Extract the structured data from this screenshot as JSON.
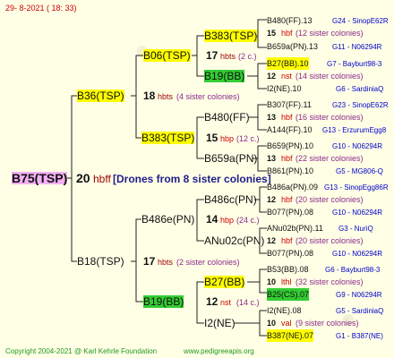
{
  "header": {
    "date": "29-  8-2021 ( 18: 33)"
  },
  "footer": {
    "copyright": "Copyright 2004-2021 @ Karl Kehrle Foundation",
    "site": "www.pedigreeapis.org"
  },
  "root": {
    "label": "B75(TSP)",
    "count": "20",
    "unit": "hbff",
    "note": "[Drones from 8 sister colonies]"
  },
  "g1": [
    {
      "label": "B36(TSP)",
      "count": "18",
      "unit": "hbts",
      "note": "(4 sister colonies)"
    },
    {
      "label": "B18(TSP)",
      "count": "17",
      "unit": "hbts",
      "note": "(2 sister colonies)"
    }
  ],
  "g2": [
    {
      "label": "B06(TSP)",
      "count": "17",
      "unit": "hbts",
      "note": "(2 c.)"
    },
    {
      "label": "B383(TSP)",
      "count": "15",
      "unit": "hbp",
      "note": "(12 c.)"
    },
    {
      "label": "B486e(PN)",
      "count": "14",
      "unit": "hbp",
      "note": "(24 c.)"
    },
    {
      "label": "B19(BB)",
      "count": "12",
      "unit": "nst",
      "note": "(14 c.)"
    }
  ],
  "g3": [
    {
      "label": "B383(TSP)"
    },
    {
      "label": "B19(BB)"
    },
    {
      "label": "B480(FF)"
    },
    {
      "label": "B659a(PN)"
    },
    {
      "label": "B486c(PN)"
    },
    {
      "label": "ANu02c(PN)"
    },
    {
      "label": "B27(BB)"
    },
    {
      "label": "I2(NE)"
    }
  ],
  "g4": [
    {
      "name": "B480(FF).13",
      "info": "G24 - SinopE62R"
    },
    {
      "count": "15",
      "unit": "hbf",
      "note": "(12 sister colonies)"
    },
    {
      "name": "B659a(PN).13",
      "info": "G11 - N06294R"
    },
    {
      "name": "B27(BB).10",
      "info": "G7 - Bayburt98-3"
    },
    {
      "count": "12",
      "unit": "nst",
      "note": "(14 sister colonies)"
    },
    {
      "name": "I2(NE).10",
      "info": "G6 - SardiniaQ"
    },
    {
      "name": "B307(FF).11",
      "info": "G23 - SinopE62R"
    },
    {
      "count": "13",
      "unit": "hbf",
      "note": "(16 sister colonies)"
    },
    {
      "name": "A144(FF).10",
      "info": "G13 - ErzurumEgg8"
    },
    {
      "name": "B659(PN).10",
      "info": "G10 - N06294R"
    },
    {
      "count": "13",
      "unit": "hbf",
      "note": "(22 sister colonies)"
    },
    {
      "name": "B861(PN).10",
      "info": "G5 - MG806-Q"
    },
    {
      "name": "B486a(PN).09",
      "info": "G13 - SinopEgg86R"
    },
    {
      "count": "12",
      "unit": "hbf",
      "note": "(20 sister colonies)"
    },
    {
      "name": "B077(PN).08",
      "info": "G10 - N06294R"
    },
    {
      "name": "ANu02b(PN).11",
      "info": "G3 - NuriQ"
    },
    {
      "count": "12",
      "unit": "hbf",
      "note": "(20 sister colonies)"
    },
    {
      "name": "B077(PN).08",
      "info": "G10 - N06294R"
    },
    {
      "name": "B53(BB).08",
      "info": "G6 - Bayburt98-3"
    },
    {
      "count": "10",
      "unit": "lthl",
      "note": "(32 sister colonies)"
    },
    {
      "name": "B25(CS).07",
      "info": "G9 - N06294R"
    },
    {
      "name": "I2(NE).08",
      "info": "G5 - SardiniaQ"
    },
    {
      "count": "10",
      "unit": "val",
      "note": "(9 sister colonies)"
    },
    {
      "name": "B387(NE).07",
      "info": "G1 - B387(NE)"
    }
  ]
}
